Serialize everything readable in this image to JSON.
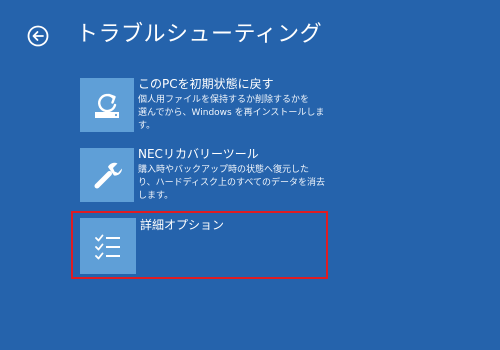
{
  "header": {
    "title": "トラブルシューティング",
    "back_icon": "back-arrow-icon"
  },
  "options": [
    {
      "title": "このPCを初期状態に戻す",
      "desc_line1": "個人用ファイルを保持するか削除するかを",
      "desc_line2": "選んでから、Windows を再インストールしま",
      "desc_line3": "す。",
      "icon": "reset-pc-icon"
    },
    {
      "title": "NECリカバリーツール",
      "desc_line1": "購入時やバックアップ時の状態へ復元した",
      "desc_line2": "り、ハードディスク上のすべてのデータを消去",
      "desc_line3": "します。",
      "icon": "wrench-icon"
    },
    {
      "title": "詳細オプション",
      "icon": "checklist-icon"
    }
  ],
  "colors": {
    "background": "#2563ac",
    "tile": "#5f9fd7",
    "highlight_border": "#e01c22"
  }
}
